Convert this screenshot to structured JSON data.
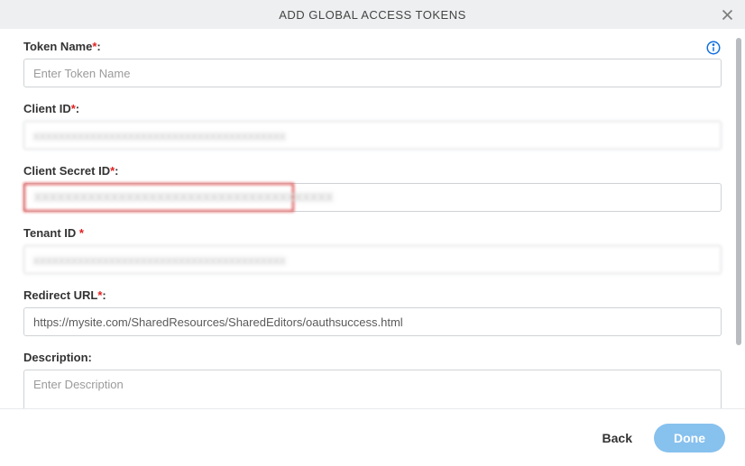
{
  "header": {
    "title": "ADD GLOBAL ACCESS TOKENS"
  },
  "fields": {
    "token_name": {
      "label": "Token Name",
      "placeholder": "Enter Token Name",
      "value": ""
    },
    "client_id": {
      "label": "Client ID",
      "value": "xxxxxxxxxxxxxxxxxxxxxxxxxxxxxxxxxxxxxxxx"
    },
    "client_secret_id": {
      "label": "Client Secret ID",
      "value": "xxxxxxxxxxxxxxxxxxxxxxxxxxxxxxxxxxxxxxx"
    },
    "tenant_id": {
      "label": "Tenant ID ",
      "value": "xxxxxxxxxxxxxxxxxxxxxxxxxxxxxxxxxxxxxxxx"
    },
    "redirect_url": {
      "label": "Redirect URL",
      "value": "https://mysite.com/SharedResources/SharedEditors/oauthsuccess.html"
    },
    "description": {
      "label": "Description:",
      "placeholder": "Enter Description",
      "value": ""
    }
  },
  "footer": {
    "back": "Back",
    "done": "Done"
  }
}
